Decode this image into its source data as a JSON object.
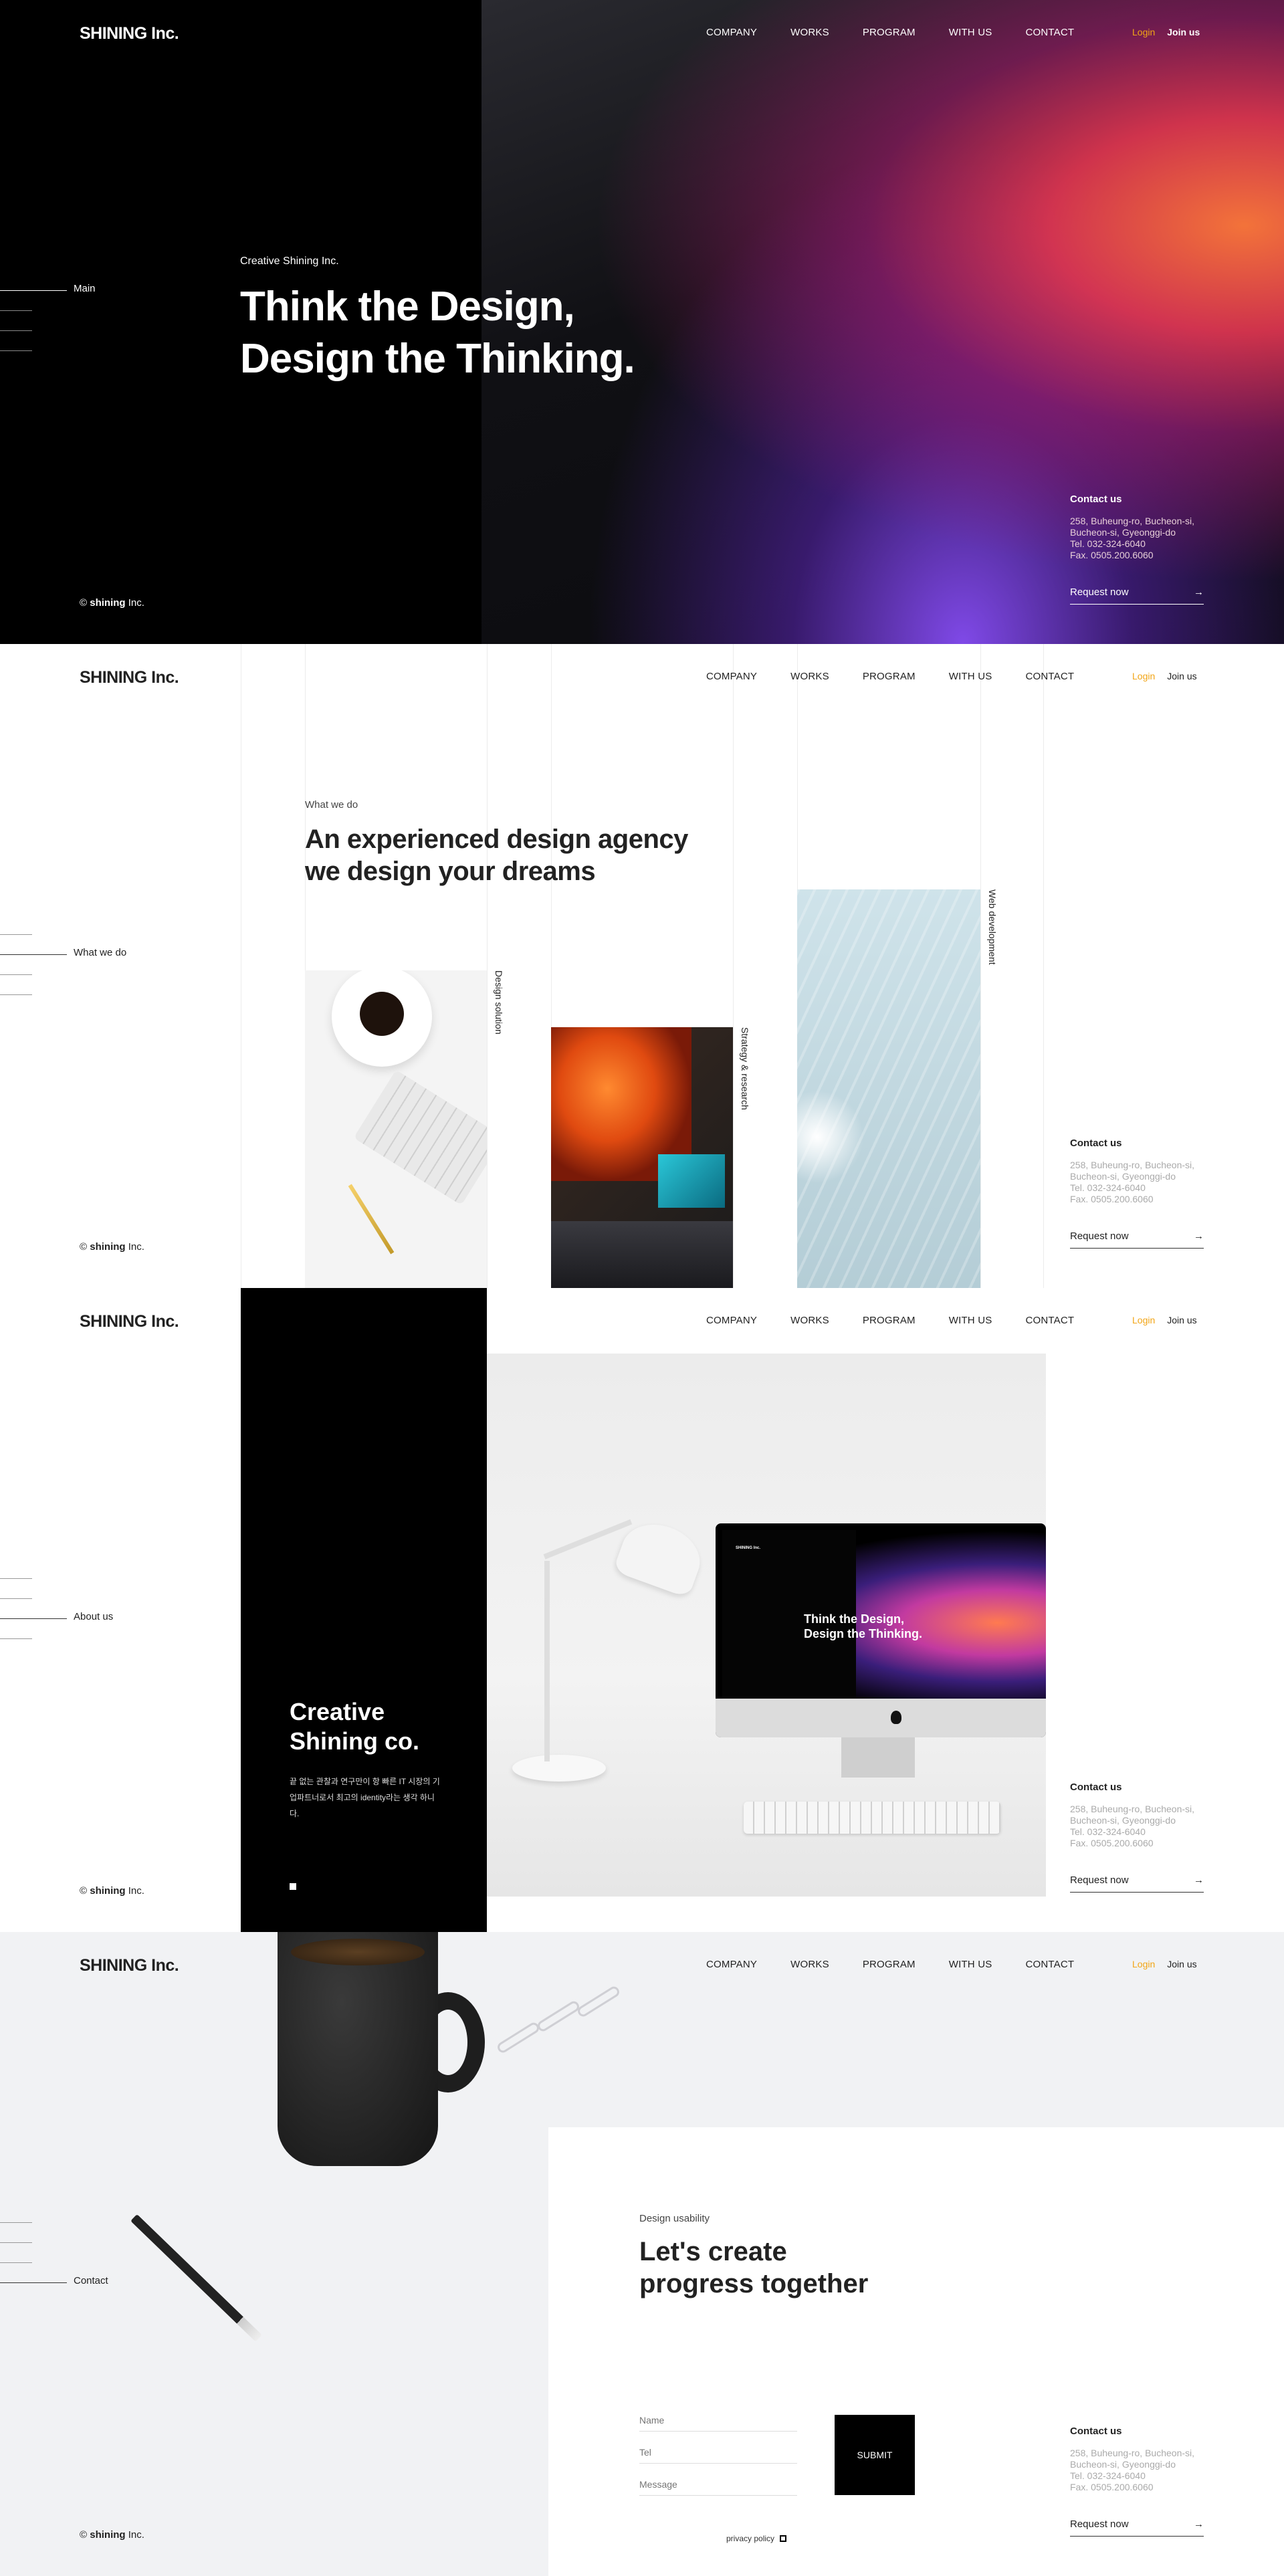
{
  "header": {
    "logo": "SHINING Inc.",
    "nav": [
      "COMPANY",
      "WORKS",
      "PROGRAM",
      "WITH US",
      "CONTACT"
    ],
    "login": "Login",
    "join": "Join us"
  },
  "copyright": {
    "symbol": "©",
    "brand": "shining",
    "suffix": "Inc."
  },
  "contact": {
    "title": "Contact us",
    "lines": [
      "258, Buheung-ro, Bucheon-si,",
      "Bucheon-si, Gyeonggi-do",
      "Tel. 032-324-6040",
      "Fax. 0505.200.6060"
    ],
    "request": "Request now",
    "arrow": "→"
  },
  "sections": {
    "main": {
      "side_label": "Main",
      "eyebrow": "Creative Shining Inc.",
      "title_line1": "Think the Design,",
      "title_line2": "Design the Thinking."
    },
    "whatwedo": {
      "side_label": "What we do",
      "eyebrow": "What we do",
      "title_line1": "An experienced design agency",
      "title_line2": "we design your dreams",
      "cards": [
        "Design solution",
        "Strategy & research",
        "Web development"
      ]
    },
    "about": {
      "side_label": "About us",
      "title_line1": "Creative",
      "title_line2": "Shining co.",
      "text": "끝 없는 관찰과 연구만이 항 빠른 IT 시장의 기업파트너로서 최고의 identity라는 생각 하니다.",
      "monitor_logo": "SHINING Inc.",
      "monitor_title_line1": "Think the Design,",
      "monitor_title_line2": "Design the Thinking."
    },
    "contact": {
      "side_label": "Contact",
      "eyebrow": "Design usability",
      "title_line1": "Let's create",
      "title_line2": "progress together",
      "fields": {
        "name": "Name",
        "tel": "Tel",
        "message": "Message"
      },
      "submit": "SUBMIT",
      "privacy": "privacy policy"
    }
  },
  "colors": {
    "accent": "#f2a516",
    "dark": "#000000",
    "light_bg": "#f1f2f4"
  }
}
